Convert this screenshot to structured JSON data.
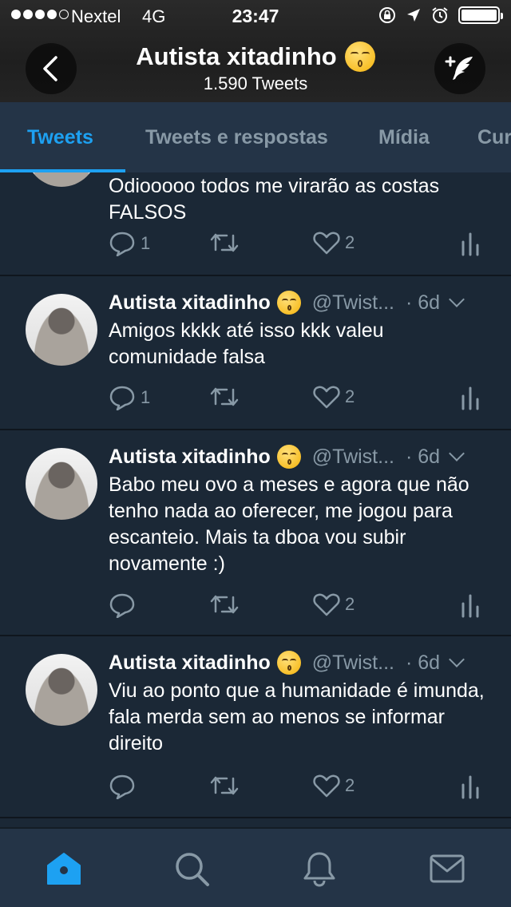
{
  "status_bar": {
    "carrier": "Nextel",
    "network": "4G",
    "time": "23:47",
    "battery_level": 1.0
  },
  "header": {
    "title": "Autista xitadinho",
    "tweet_count": "1.590 Tweets",
    "title_emoji": "kissing-face-emoji"
  },
  "tabs": [
    {
      "label": "Tweets",
      "active": true
    },
    {
      "label": "Tweets e respostas",
      "active": false
    },
    {
      "label": "Mídia",
      "active": false
    },
    {
      "label": "Curtidas",
      "active": false
    }
  ],
  "tweets": [
    {
      "name": "",
      "handle": "",
      "time": "",
      "text": "Odiooooo todos me virarão as costas\nFALSOS",
      "replies": "1",
      "likes": "2"
    },
    {
      "name": "Autista xitadinho",
      "handle": "@Twist...",
      "time": "· 6d",
      "text": "Amigos kkkk até isso kkk valeu comunidade falsa",
      "replies": "1",
      "likes": "2"
    },
    {
      "name": "Autista xitadinho",
      "handle": "@Twist...",
      "time": "· 6d",
      "text": "Babo meu ovo a meses e agora que não tenho nada ao oferecer, me jogou para escanteio. Mais ta dboa vou subir novamente :)",
      "replies": "",
      "likes": "2"
    },
    {
      "name": "Autista xitadinho",
      "handle": "@Twist...",
      "time": "· 6d",
      "text": "Viu ao ponto que a humanidade é imunda, fala merda sem ao menos se informar direito",
      "replies": "",
      "likes": "2"
    }
  ],
  "tabbar": {
    "items": [
      "home-icon",
      "search-icon",
      "notifications-icon",
      "messages-icon"
    ],
    "active": "home-icon"
  },
  "colors": {
    "accent": "#1da1f2",
    "background": "#1b2836",
    "secondary_text": "#8899a6"
  }
}
